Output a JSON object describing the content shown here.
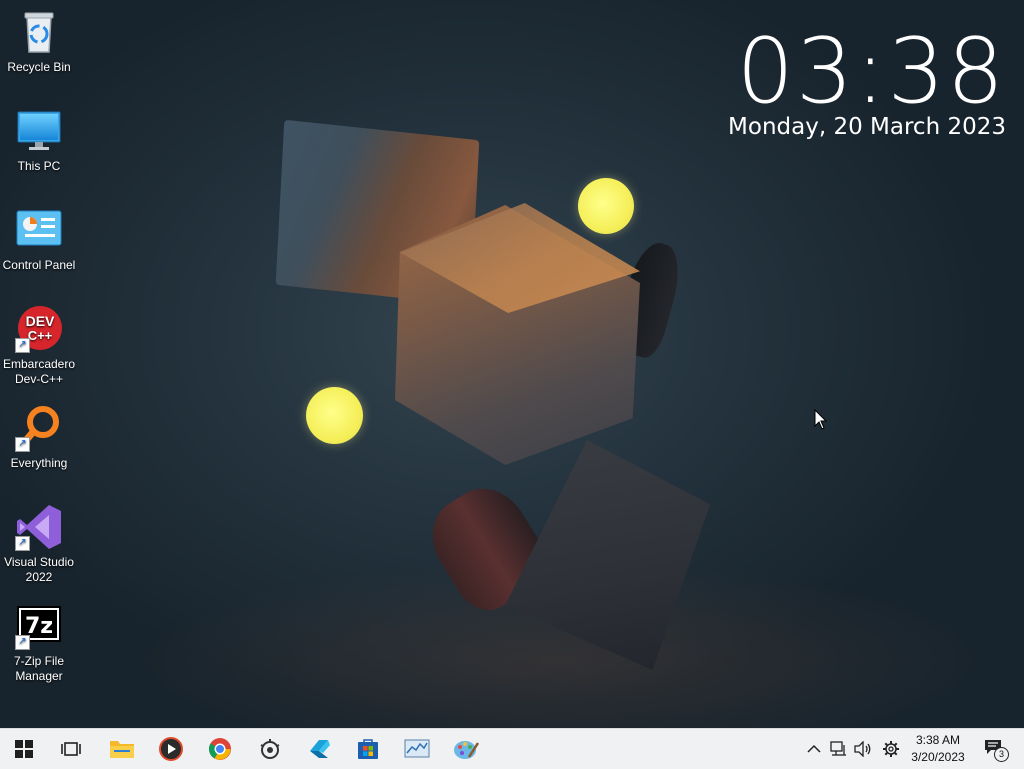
{
  "desktop": {
    "clock_time": "03:38",
    "clock_date": "Monday, 20 March 2023",
    "icons": [
      {
        "label": "Recycle Bin",
        "icon": "recycle-bin-icon"
      },
      {
        "label": "This PC",
        "icon": "this-pc-icon"
      },
      {
        "label": "Control Panel",
        "icon": "control-panel-icon"
      },
      {
        "label": "Embarcadero Dev-C++",
        "icon": "dev-cpp-icon",
        "glyph_text": "DEV C++"
      },
      {
        "label": "Everything",
        "icon": "everything-search-icon"
      },
      {
        "label": "Visual Studio 2022",
        "icon": "visual-studio-icon"
      },
      {
        "label": "7-Zip File Manager",
        "icon": "seven-zip-icon",
        "glyph_text": "7z"
      }
    ]
  },
  "taskbar": {
    "pinned": [
      {
        "name": "start",
        "icon": "windows-start-icon"
      },
      {
        "name": "task-view",
        "icon": "task-view-icon"
      },
      {
        "name": "file-explorer",
        "icon": "folder-icon"
      },
      {
        "name": "media-player",
        "icon": "media-player-icon"
      },
      {
        "name": "chrome",
        "icon": "chrome-icon"
      },
      {
        "name": "settings-app",
        "icon": "steam-like-icon"
      },
      {
        "name": "app-blue",
        "icon": "app-blue-icon"
      },
      {
        "name": "store",
        "icon": "microsoft-store-icon"
      },
      {
        "name": "monitor",
        "icon": "monitor-icon"
      },
      {
        "name": "paint",
        "icon": "paint-icon"
      }
    ],
    "tray": {
      "time": "3:38 AM",
      "date": "3/20/2023",
      "notification_count": "3"
    }
  },
  "colors": {
    "taskbar_bg": "#f0f1f3",
    "accent_blue": "#1967d2",
    "ball_yellow": "#f5ef5a"
  }
}
